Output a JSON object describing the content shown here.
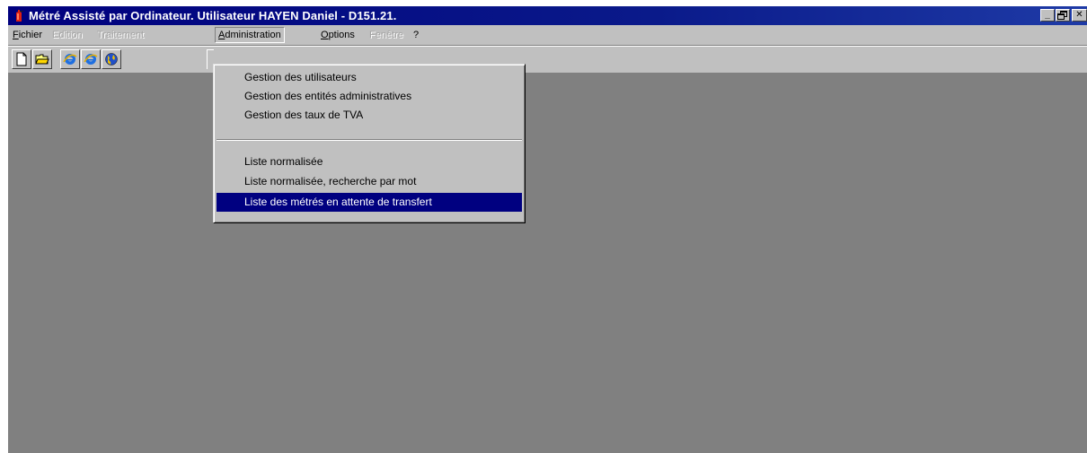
{
  "window": {
    "title": "Métré Assisté par Ordinateur. Utilisateur HAYEN Daniel - D151.21.",
    "controls": {
      "minimize": "_",
      "restore": "▫",
      "close": "✕"
    }
  },
  "menubar": {
    "items": [
      {
        "label": "Fichier",
        "accel": "F",
        "rest": "ichier",
        "enabled": true
      },
      {
        "label": "Edition",
        "enabled": false
      },
      {
        "label": "Traitement",
        "enabled": false
      },
      {
        "label": "Administration",
        "accel": "A",
        "rest": "dministration",
        "enabled": true,
        "open": true
      },
      {
        "label": "Options",
        "accel": "O",
        "rest": "ptions",
        "enabled": true
      },
      {
        "label": "Fenêtre",
        "enabled": false
      },
      {
        "label": "?",
        "enabled": true
      }
    ]
  },
  "toolbar": {
    "buttons": [
      {
        "icon": "new-document-icon"
      },
      {
        "icon": "open-folder-icon"
      },
      {
        "icon": "internet-explorer-icon"
      },
      {
        "icon": "internet-explorer-icon"
      },
      {
        "icon": "globe-icon"
      }
    ]
  },
  "dropdown": {
    "groups": [
      [
        {
          "label": "Gestion des utilisateurs"
        },
        {
          "label": "Gestion des entités administratives"
        },
        {
          "label": "Gestion des taux de TVA"
        }
      ],
      [
        {
          "label": "Liste normalisée"
        },
        {
          "label": "Liste normalisée, recherche par mot"
        },
        {
          "label": "Liste des métrés en attente de transfert",
          "selected": true
        }
      ]
    ]
  },
  "colors": {
    "titlebar": "#00007e",
    "menu_highlight": "#000080",
    "face": "#c0c0c0",
    "workspace": "#808080"
  }
}
